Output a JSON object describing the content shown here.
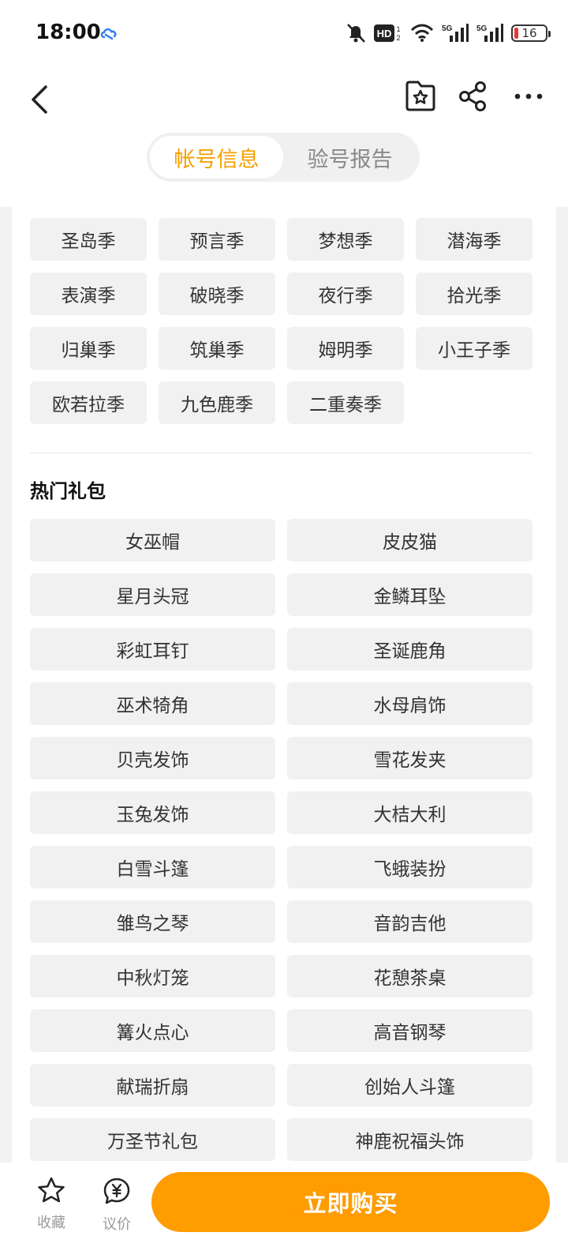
{
  "status_bar": {
    "time": "18:00",
    "battery": "16",
    "icons": [
      "cloud-icon",
      "mute-icon",
      "hd-icon",
      "wifi-icon",
      "signal-5g-icon",
      "signal-5g-icon",
      "battery-icon"
    ]
  },
  "nav": {
    "icons": [
      "back-icon",
      "favorite-box-icon",
      "share-icon",
      "more-icon"
    ],
    "tabs": [
      {
        "label": "帐号信息",
        "active": true
      },
      {
        "label": "验号报告",
        "active": false
      }
    ]
  },
  "seasons": [
    "圣岛季",
    "预言季",
    "梦想季",
    "潜海季",
    "表演季",
    "破晓季",
    "夜行季",
    "拾光季",
    "归巢季",
    "筑巢季",
    "姆明季",
    "小王子季",
    "欧若拉季",
    "九色鹿季",
    "二重奏季"
  ],
  "gift_section": {
    "title": "热门礼包",
    "items": [
      "女巫帽",
      "皮皮猫",
      "星月头冠",
      "金鳞耳坠",
      "彩虹耳钉",
      "圣诞鹿角",
      "巫术犄角",
      "水母肩饰",
      "贝壳发饰",
      "雪花发夹",
      "玉兔发饰",
      "大桔大利",
      "白雪斗篷",
      "飞蛾装扮",
      "雏鸟之琴",
      "音韵吉他",
      "中秋灯笼",
      "花憩茶桌",
      "篝火点心",
      "高音钢琴",
      "献瑞折扇",
      "创始人斗篷",
      "万圣节礼包",
      "神鹿祝福头饰"
    ]
  },
  "bottom_bar": {
    "favorite_label": "收藏",
    "bargain_label": "议价",
    "buy_label": "立即购买"
  },
  "colors": {
    "accent": "#ff9c00",
    "tab_active_text": "#f5a000",
    "chip_bg": "#f1f1f1",
    "page_bg": "#f2f2f2"
  }
}
